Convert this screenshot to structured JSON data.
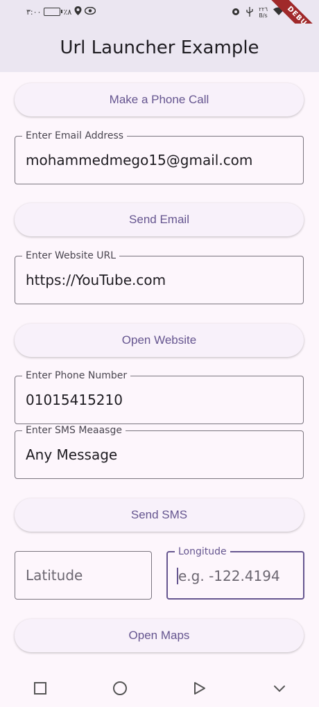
{
  "status_bar": {
    "time": "٣:٠٠",
    "battery": "٪٨",
    "net_speed_value": "٢٢٦",
    "net_speed_unit": "B/s"
  },
  "debug_banner": "DEBUG",
  "app_bar": {
    "title": "Url Launcher Example"
  },
  "phone_call_button": "Make a Phone Call",
  "email_field": {
    "label": "Enter Email Address",
    "value": "mohammedmego15@gmail.com"
  },
  "send_email_button": "Send Email",
  "website_field": {
    "label": "Enter Website URL",
    "value": "https://YouTube.com"
  },
  "open_website_button": "Open Website",
  "phone_field": {
    "label": "Enter Phone Number",
    "value": "01015415210"
  },
  "sms_field": {
    "label": "Enter SMS Meaasge",
    "value": "Any Message"
  },
  "send_sms_button": "Send SMS",
  "latitude_field": {
    "placeholder": "Latitude"
  },
  "longitude_field": {
    "label": "Longitude",
    "placeholder": "e.g. -122.4194"
  },
  "open_maps_button": "Open Maps",
  "icons": {
    "status": [
      "battery-icon",
      "location-icon",
      "eye-icon",
      "settings-icon",
      "usb-icon",
      "wifi-icon"
    ],
    "navigation": [
      "recent-apps-icon",
      "home-icon",
      "back-icon",
      "hide-keyboard-icon"
    ]
  },
  "colors": {
    "accent": "#65558f",
    "background": "#fdf6fc",
    "app_bar": "#ebe6f1"
  }
}
